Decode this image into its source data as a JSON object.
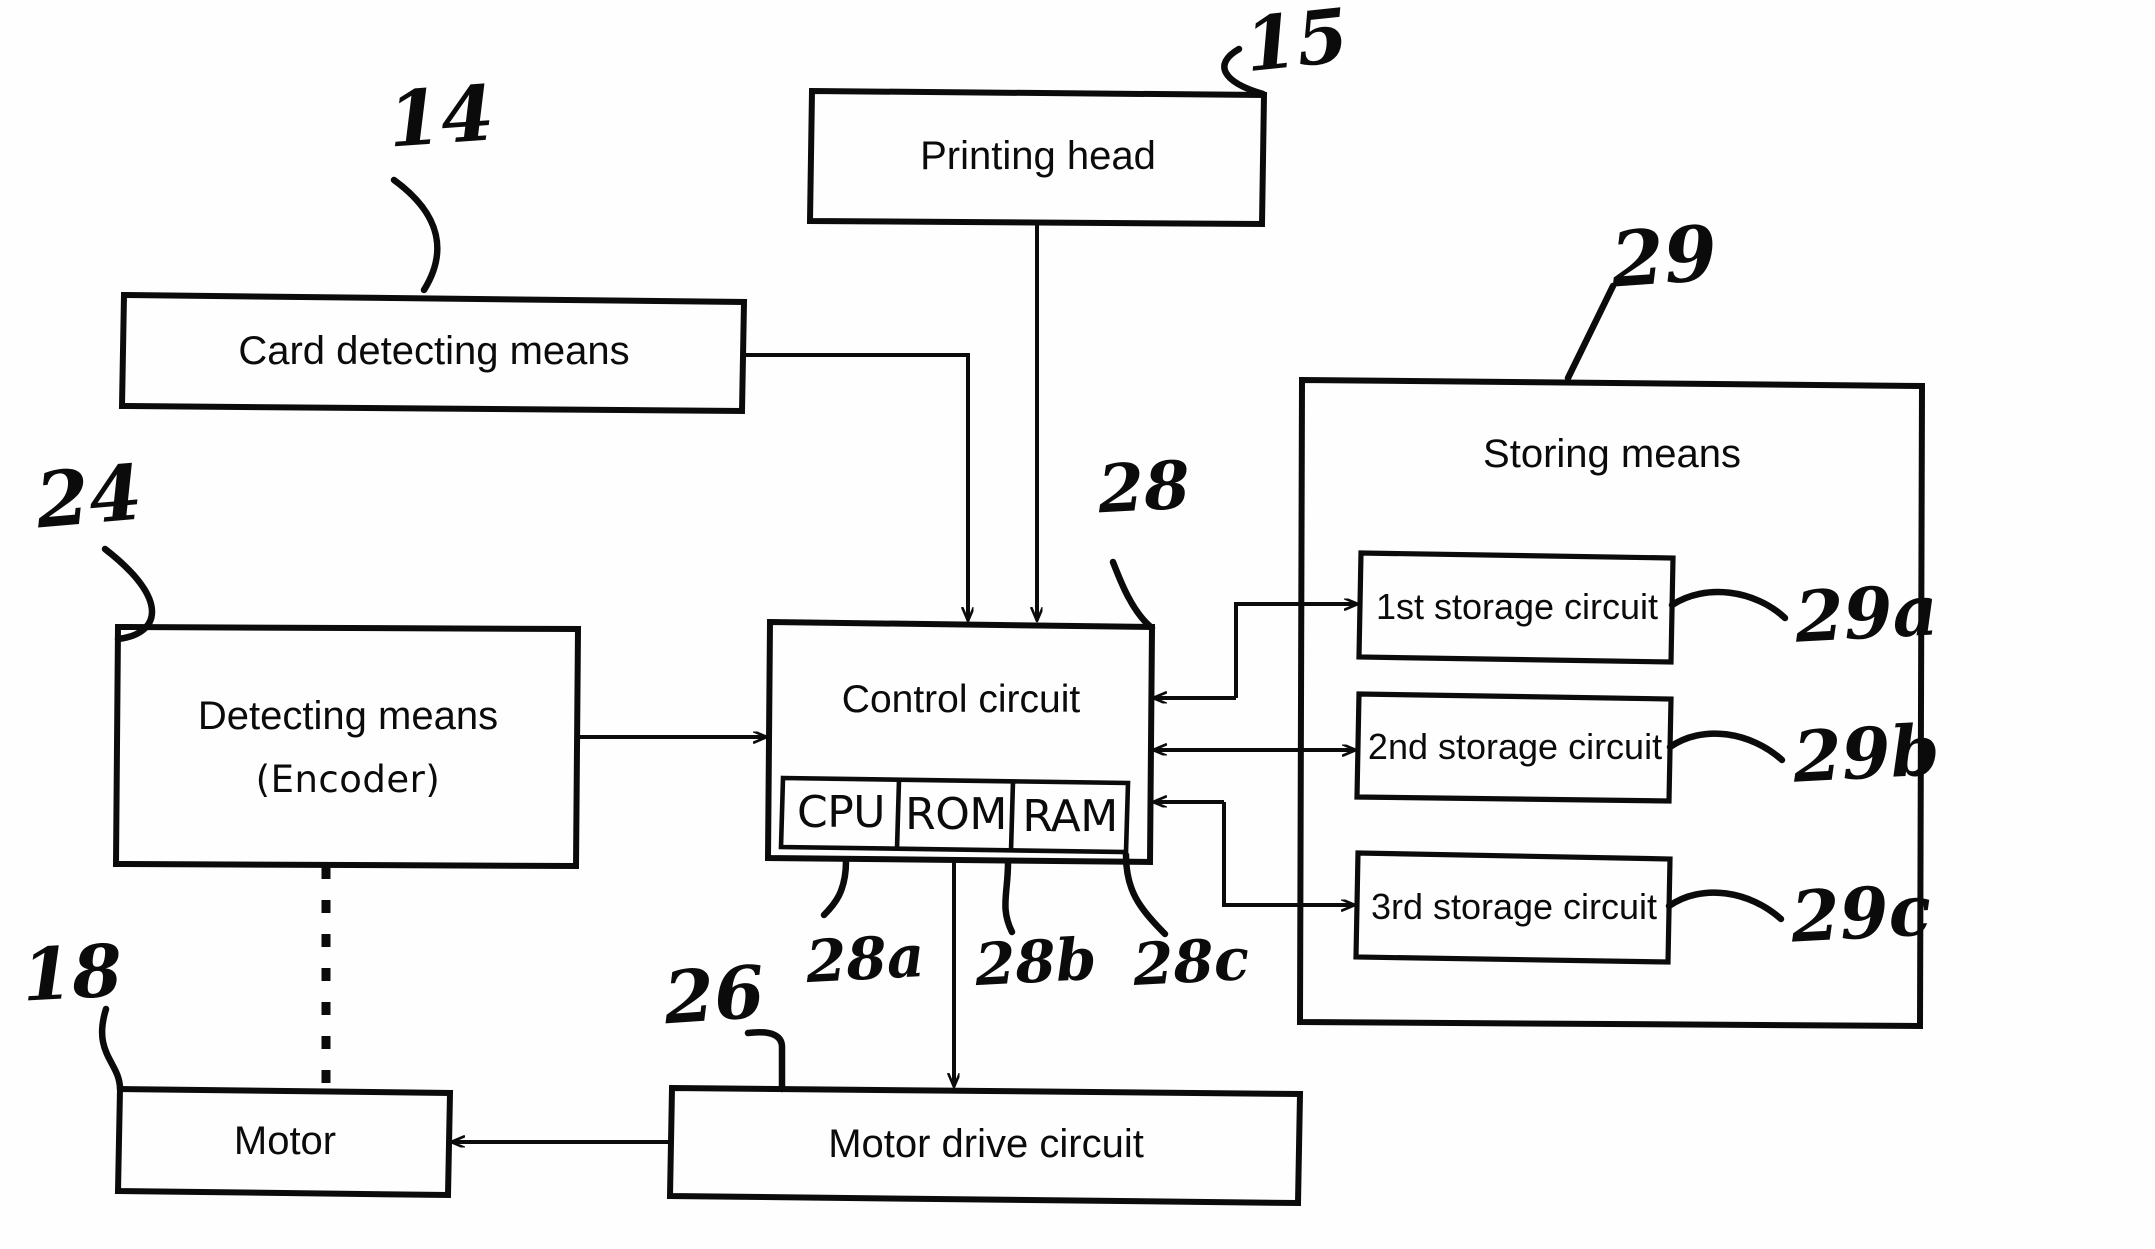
{
  "figure": {
    "kind": "patent-block-diagram",
    "ink_color": "#0b0b0b",
    "paper_color": "#fefefe"
  },
  "blocks": {
    "printing_head": {
      "label": "Printing head"
    },
    "card_detecting": {
      "label": "Card detecting means"
    },
    "detecting_means": {
      "line1": "Detecting means",
      "line2": "(Encoder)"
    },
    "control_circuit": {
      "label": "Control circuit"
    },
    "storing_means": {
      "label": "Storing means"
    },
    "storage_1": {
      "label": "1st storage circuit"
    },
    "storage_2": {
      "label": "2nd storage circuit"
    },
    "storage_3": {
      "label": "3rd storage circuit"
    },
    "motor": {
      "label": "Motor"
    },
    "motor_drive": {
      "label": "Motor drive circuit"
    }
  },
  "memory_units": {
    "cpu": "CPU",
    "rom": "ROM",
    "ram": "RAM"
  },
  "reference_numerals": {
    "printing_head": "15",
    "card_detecting": "14",
    "detecting_means": "24",
    "control_circuit": "28",
    "cpu": "28a",
    "rom": "28b",
    "ram": "28c",
    "storing_means": "29",
    "storage_1": "29a",
    "storage_2": "29b",
    "storage_3": "29c",
    "motor": "18",
    "motor_drive": "26"
  }
}
